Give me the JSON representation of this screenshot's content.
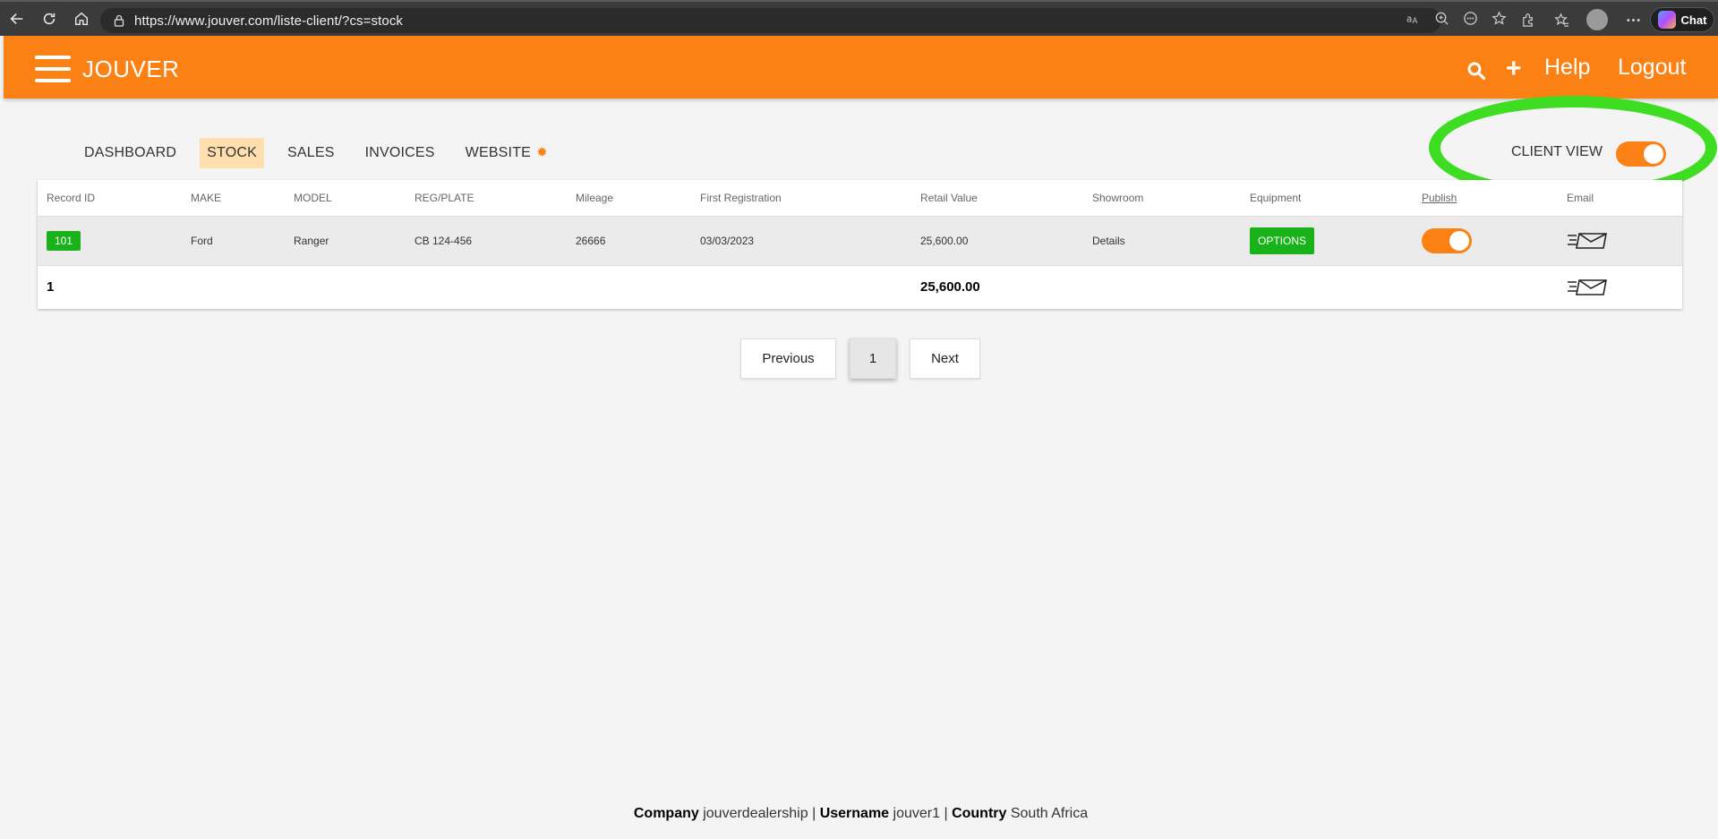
{
  "browser": {
    "url": "https://www.jouver.com/liste-client/?cs=stock",
    "chat_label": "Chat"
  },
  "header": {
    "brand": "JOUVER",
    "plus": "+",
    "help": "Help",
    "logout": "Logout"
  },
  "tabs": [
    "DASHBOARD",
    "STOCK",
    "SALES",
    "INVOICES",
    "WEBSITE"
  ],
  "active_tab": "STOCK",
  "client_view": {
    "label": "CLIENT VIEW",
    "enabled": true
  },
  "table": {
    "columns": [
      "Record ID",
      "MAKE",
      "MODEL",
      "REG/PLATE",
      "Mileage",
      "First Registration",
      "Retail Value",
      "Showroom",
      "Equipment",
      "Publish",
      "Email"
    ],
    "rows": [
      {
        "record_id": "101",
        "make": "Ford",
        "model": "Ranger",
        "reg_plate": "CB 124-456",
        "mileage": "26666",
        "first_registration": "03/03/2023",
        "retail_value": "25,600.00",
        "showroom": "Details",
        "equipment": "OPTIONS",
        "publish": true
      }
    ],
    "totals": {
      "count": "1",
      "retail_value": "25,600.00"
    }
  },
  "pagination": {
    "previous": "Previous",
    "current_page": "1",
    "next": "Next"
  },
  "footer": {
    "company_label": "Company",
    "company": "jouverdealership",
    "sep1": "|",
    "username_label": "Username",
    "username": "jouver1",
    "sep2": "|",
    "country_label": "Country",
    "country": "South Africa"
  },
  "colors": {
    "brand_orange": "#fb8115",
    "active_tab": "#ffdfae",
    "badge_green": "#1ab21a",
    "highlight_ring": "#3fdd22"
  }
}
